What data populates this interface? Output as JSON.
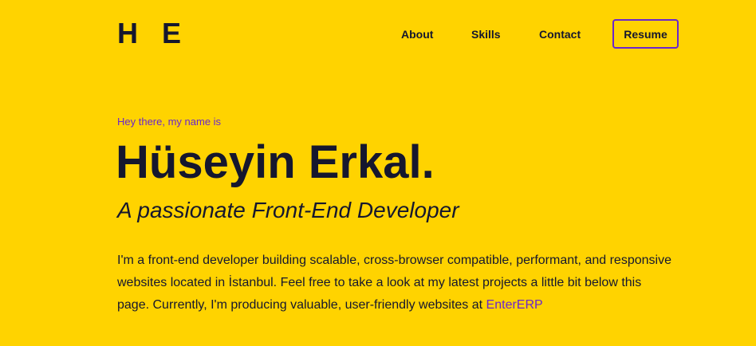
{
  "header": {
    "logo": "H E",
    "nav": {
      "about": "About",
      "skills": "Skills",
      "contact": "Contact"
    },
    "resume_label": "Resume"
  },
  "hero": {
    "greeting": "Hey there, my name is",
    "name": "Hüseyin Erkal.",
    "tagline": "A passionate Front-End Developer",
    "bio_text": "I'm a front-end developer building scalable, cross-browser compatible, performant, and responsive websites located in İstanbul. Feel free to take a look at my latest projects a little bit below this page. Currently, I'm producing valuable, user-friendly websites at ",
    "bio_link": "EnterERP"
  },
  "colors": {
    "background": "#FFD300",
    "text": "#15172E",
    "accent": "#6A26CD"
  }
}
